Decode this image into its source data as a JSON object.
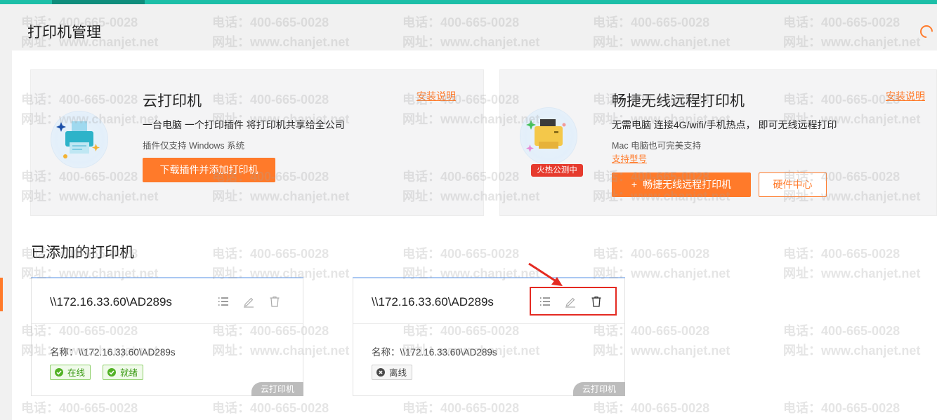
{
  "header": {
    "title": "打印机管理"
  },
  "cloud_printer": {
    "title": "云打印机",
    "install_link": "安装说明",
    "desc": "一台电脑 一个打印插件 将打印机共享给全公司",
    "note": "插件仅支持 Windows 系统",
    "button": "下载插件并添加打印机"
  },
  "wireless_printer": {
    "title": "畅捷无线远程打印机",
    "install_link": "安装说明",
    "desc": "无需电脑 连接4G/wifi/手机热点， 即可无线远程打印",
    "note": "Mac 电脑也可完美支持",
    "models_link": "支持型号",
    "promo_ribbon": "火热公测中",
    "button": "畅捷无线远程打印机",
    "button_icon": "+",
    "hardware_button": "硬件中心"
  },
  "added_section": {
    "title": "已添加的打印机"
  },
  "printers": [
    {
      "path": "\\\\172.16.33.60\\AD289s",
      "name_label": "名称：",
      "name_value": "\\\\172.16.33.60\\AD289s",
      "tags": [
        "在线",
        "就绪"
      ],
      "badge": "云打印机"
    },
    {
      "path": "\\\\172.16.33.60\\AD289s",
      "name_label": "名称：",
      "name_value": "\\\\172.16.33.60\\AD289s",
      "tags": [
        "离线"
      ],
      "badge": "云打印机"
    }
  ],
  "watermark": {
    "line1": "电话：400-665-0028",
    "line2": "网址：www.chanjet.net"
  },
  "colors": {
    "accent": "#ff7a2a",
    "teal": "#1dbfa8",
    "online_green": "#52b125",
    "highlight_red": "#e42a22"
  },
  "icons": [
    "refresh-icon",
    "printer-icon",
    "wireless-printer-icon",
    "list-icon",
    "edit-icon",
    "delete-icon",
    "check-icon",
    "close-icon",
    "arrow-icon"
  ]
}
